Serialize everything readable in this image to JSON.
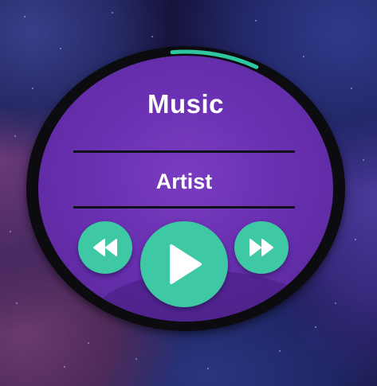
{
  "player": {
    "title": "Music",
    "artist": "Artist"
  },
  "playback": {
    "progress_fraction": 0.09
  },
  "controls": {
    "rewind_icon": "rewind-icon",
    "play_icon": "play-icon",
    "fast_forward_icon": "fast-forward-icon"
  },
  "colors": {
    "accent": "#3ec8a4",
    "screen": "#6a30b2",
    "bezel": "#0b0b10",
    "progress": "#2fc7a0"
  }
}
